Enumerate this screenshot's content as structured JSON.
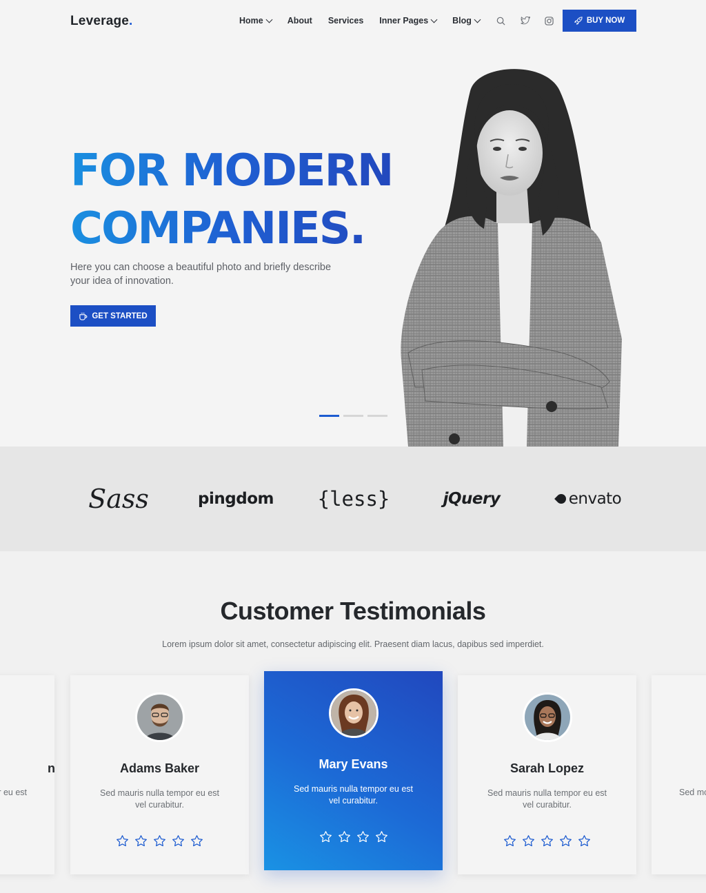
{
  "header": {
    "logo": "Leverage",
    "logo_dot": ".",
    "nav": [
      {
        "label": "Home",
        "dropdown": true
      },
      {
        "label": "About",
        "dropdown": false
      },
      {
        "label": "Services",
        "dropdown": false
      },
      {
        "label": "Inner Pages",
        "dropdown": true
      },
      {
        "label": "Blog",
        "dropdown": true
      }
    ],
    "icons": [
      "search-icon",
      "twitter-icon",
      "instagram-icon"
    ],
    "buy_label": "BUY NOW"
  },
  "hero": {
    "title_line1": "FOR MODERN",
    "title_line2": "COMPANIES.",
    "description": "Here you can choose a beautiful photo and briefly describe your idea of innovation.",
    "cta_label": "GET STARTED",
    "slides": 3,
    "active_slide": 1
  },
  "brands": [
    "Sass",
    "pingdom",
    "{less}",
    "jQuery",
    "envato"
  ],
  "testimonials": {
    "title": "Customer Testimonials",
    "subtitle": "Lorem ipsum dolor sit amet, consectetur adipiscing elit. Praesent diam lacus, dapibus sed imperdiet.",
    "cards": [
      {
        "name": "Adams Baker",
        "text": "Sed mauris nulla tempor eu est vel curabitur.",
        "stars": 5
      },
      {
        "name": "Mary Evans",
        "text": "Sed mauris nulla tempor eu est vel curabitur.",
        "stars": 4
      },
      {
        "name": "Sarah Lopez",
        "text": "Sed mauris nulla tempor eu est vel curabitur.",
        "stars": 5
      }
    ],
    "edge_left": {
      "name_fragment": "n",
      "text_fragment": "r eu est"
    },
    "edge_right": {
      "name_fragment": "",
      "text_fragment": "Sed mc"
    }
  },
  "colors": {
    "primary": "#1c4fc4",
    "gradient_start": "#1a8fe0",
    "gradient_end": "#2248bd",
    "page_bg": "#f4f4f4",
    "logo_band_bg": "#e6e6e6"
  }
}
